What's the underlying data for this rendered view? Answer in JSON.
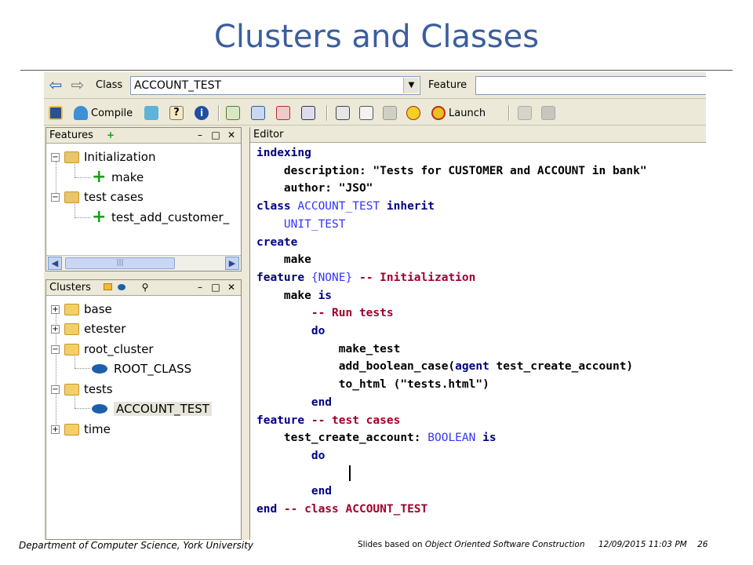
{
  "slide": {
    "title": "Clusters and Classes",
    "footer_left": "Department of Computer Science, York University",
    "footer_prefix": "Slides based on ",
    "footer_book": "Object Oriented Software Construction",
    "footer_datetime": "12/09/2015 11:03 PM",
    "footer_page": "26"
  },
  "address_bar": {
    "class_label": "Class",
    "class_value": "ACCOUNT_TEST",
    "feature_label": "Feature",
    "feature_value": ""
  },
  "toolbar": {
    "compile_label": "Compile",
    "launch_label": "Launch"
  },
  "features_panel": {
    "title": "Features",
    "title_icon": "+",
    "items": [
      {
        "label": "Initialization",
        "expander": "−"
      },
      {
        "label": "make"
      },
      {
        "label": "test cases",
        "expander": "−"
      },
      {
        "label": "test_add_customer_"
      }
    ]
  },
  "clusters_panel": {
    "title": "Clusters",
    "items": [
      {
        "label": "base",
        "expander": "+"
      },
      {
        "label": "etester",
        "expander": "+"
      },
      {
        "label": "root_cluster",
        "expander": "−"
      },
      {
        "label": "ROOT_CLASS"
      },
      {
        "label": "tests",
        "expander": "−"
      },
      {
        "label": "ACCOUNT_TEST"
      },
      {
        "label": "time",
        "expander": "+"
      }
    ]
  },
  "editor": {
    "title": "Editor",
    "lines": [
      {
        "t1": "indexing"
      },
      {
        "t1": "    description: \"Tests for CUSTOMER and ACCOUNT in bank\""
      },
      {
        "t1": "    author: \"JSO\""
      },
      {
        "t1": "class ",
        "t2": "ACCOUNT_TEST",
        "t3": " inherit"
      },
      {
        "t1": "    ",
        "t2": "UNIT_TEST"
      },
      {
        "t1": "create"
      },
      {
        "t1": "    make"
      },
      {
        "t1": "feature ",
        "t2": "{NONE}",
        "t3": " -- Initialization"
      },
      {
        "t1": "    make ",
        "t2": "is"
      },
      {
        "t1": "        -- Run tests"
      },
      {
        "t1": "        do"
      },
      {
        "t1": "            make_test"
      },
      {
        "t1": "            add_boolean_case(",
        "t2": "agent",
        "t3": " test_create_account)"
      },
      {
        "t1": "            to_html (\"tests.html\")"
      },
      {
        "t1": "        end"
      },
      {
        "t1": "feature",
        "t2": " -- test cases"
      },
      {
        "t1": "    test_create_account: ",
        "t2": "BOOLEAN",
        "t3": " is"
      },
      {
        "t1": "        do"
      },
      {
        "t1": ""
      },
      {
        "t1": "        end"
      },
      {
        "t1": "end",
        "t2": " -- class ACCOUNT_TEST"
      }
    ]
  },
  "colors": {
    "title_blue": "#3b5e9e",
    "keyword": "#000080",
    "comment": "#a0002e",
    "class_name": "#3434ff",
    "chrome": "#ece9d8"
  }
}
